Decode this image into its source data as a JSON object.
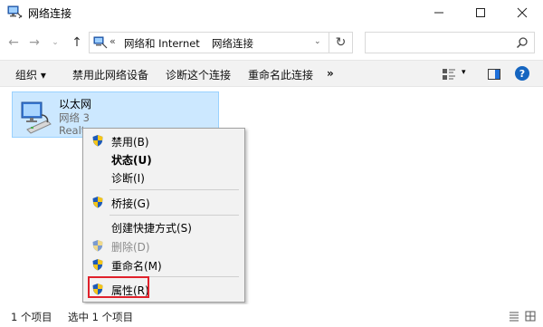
{
  "window": {
    "title": "网络连接",
    "controls": {
      "minimize": "—",
      "maximize": "☐",
      "close": "✕"
    }
  },
  "nav": {
    "back": "←",
    "forward": "→",
    "recent": "⌄",
    "up": "↑"
  },
  "address": {
    "overflow": "«",
    "crumbs": [
      "网络和 Internet",
      "网络连接"
    ],
    "separator": "›",
    "dropdown": "⌄",
    "refresh": "↻"
  },
  "search": {
    "placeholder": ""
  },
  "commands": {
    "organize": "组织 ▾",
    "disable_device": "禁用此网络设备",
    "diagnose": "诊断这个连接",
    "rename": "重命名此连接",
    "more": "»",
    "view_dropdown": "▾",
    "help": "?"
  },
  "connection": {
    "name": "以太网",
    "network": "网络 3",
    "adapter": "Realt"
  },
  "context_menu": {
    "items": [
      {
        "label": "禁用(B)",
        "shield": true,
        "bold": false,
        "disabled": false
      },
      {
        "label": "状态(U)",
        "shield": false,
        "bold": true,
        "disabled": false
      },
      {
        "label": "诊断(I)",
        "shield": false,
        "bold": false,
        "disabled": false
      },
      {
        "label": "桥接(G)",
        "shield": true,
        "bold": false,
        "disabled": false
      },
      {
        "label": "创建快捷方式(S)",
        "shield": false,
        "bold": false,
        "disabled": false
      },
      {
        "label": "删除(D)",
        "shield": true,
        "bold": false,
        "disabled": true
      },
      {
        "label": "重命名(M)",
        "shield": true,
        "bold": false,
        "disabled": false
      },
      {
        "label": "属性(R)",
        "shield": true,
        "bold": false,
        "disabled": false
      }
    ],
    "highlight_color": "#e0212b"
  },
  "status": {
    "count": "1 个项目",
    "selected": "选中 1 个项目"
  },
  "colors": {
    "selection_bg": "#cce8ff",
    "selection_border": "#99d1ff",
    "menu_bg": "#f2f2f2",
    "help_blue": "#1565c0"
  }
}
